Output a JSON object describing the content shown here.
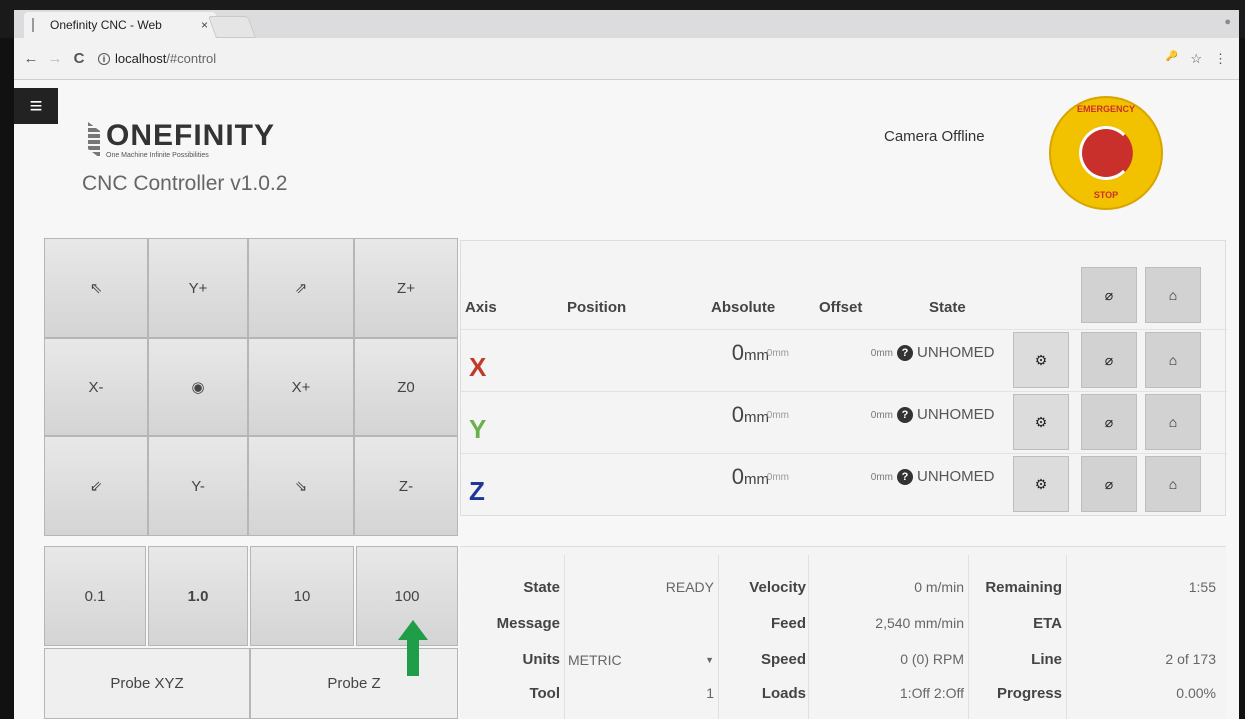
{
  "browser": {
    "tab_title": "Onefinity CNC - Web",
    "tab_close": "×",
    "url_host": "localhost",
    "url_path": "/#control",
    "back": "←",
    "forward": "→",
    "reload": "C",
    "key_icon": "🔑",
    "star_icon": "☆",
    "menu_icon": "⋮"
  },
  "header": {
    "menu_icon": "≡",
    "logo_text": "ONEFINITY",
    "logo_tagline": "One Machine Infinite Possibilities",
    "app_title": "CNC Controller v1.0.2",
    "camera_status": "Camera Offline",
    "estop_top": "EMERGENCY",
    "estop_bottom": "STOP"
  },
  "jog": {
    "buttons": [
      "⇖",
      "Y+",
      "⇗",
      "Z+",
      "X-",
      "◉",
      "X+",
      "Z0",
      "⇙",
      "Y-",
      "⇘",
      "Z-"
    ],
    "steps": [
      "0.1",
      "1.0",
      "10",
      "100"
    ],
    "selected_step": "1.0",
    "probe_xyz": "Probe XYZ",
    "probe_z": "Probe Z"
  },
  "axes": {
    "headers": {
      "axis": "Axis",
      "position": "Position",
      "absolute": "Absolute",
      "offset": "Offset",
      "state": "State"
    },
    "header_buttons": [
      "⌀",
      "⌂"
    ],
    "rows": [
      {
        "letter": "X",
        "color": "#c0392b",
        "position": "0",
        "pos_unit": "mm",
        "absolute": "0mm",
        "offset": "0mm",
        "state": "UNHOMED"
      },
      {
        "letter": "Y",
        "color": "#6ab04c",
        "position": "0",
        "pos_unit": "mm",
        "absolute": "0mm",
        "offset": "0mm",
        "state": "UNHOMED"
      },
      {
        "letter": "Z",
        "color": "#1e3799",
        "position": "0",
        "pos_unit": "mm",
        "absolute": "0mm",
        "offset": "0mm",
        "state": "UNHOMED"
      }
    ],
    "row_buttons": [
      "⚙",
      "⌀",
      "⌂"
    ]
  },
  "status": {
    "state_label": "State",
    "state_value": "READY",
    "message_label": "Message",
    "message_value": "",
    "units_label": "Units",
    "units_value": "METRIC",
    "tool_label": "Tool",
    "tool_value": "1",
    "velocity_label": "Velocity",
    "velocity_value": "0 m/min",
    "feed_label": "Feed",
    "feed_value": "2,540 mm/min",
    "speed_label": "Speed",
    "speed_value": "0 (0) RPM",
    "loads_label": "Loads",
    "loads_value": "1:Off 2:Off",
    "remaining_label": "Remaining",
    "remaining_value": "1:55",
    "eta_label": "ETA",
    "eta_value": "",
    "line_label": "Line",
    "line_value": "2 of 173",
    "progress_label": "Progress",
    "progress_value": "0.00%"
  },
  "colors": {
    "green_arrow": "#1f9d49",
    "blue_arrow": "#1436d8"
  }
}
